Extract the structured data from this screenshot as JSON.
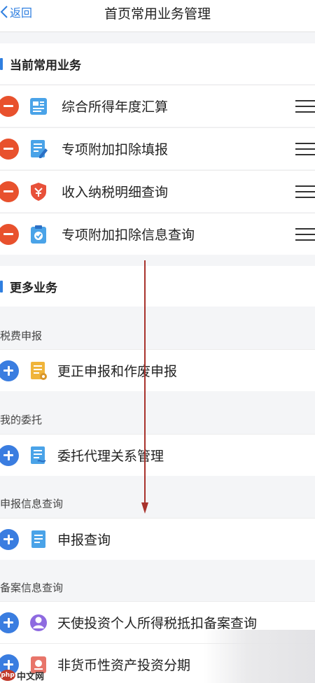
{
  "nav": {
    "back_label": "返回",
    "title": "首页常用业务管理"
  },
  "current": {
    "title": "当前常用业务",
    "items": [
      {
        "label": "综合所得年度汇算",
        "icon": "annual-settlement-icon"
      },
      {
        "label": "专项附加扣除填报",
        "icon": "form-edit-icon"
      },
      {
        "label": "收入纳税明细查询",
        "icon": "tax-shield-icon"
      },
      {
        "label": "专项附加扣除信息查询",
        "icon": "clipboard-check-icon"
      }
    ]
  },
  "more": {
    "title": "更多业务",
    "groups": [
      {
        "label": "税费申报",
        "items": [
          {
            "label": "更正申报和作废申报",
            "icon": "correction-doc-icon"
          }
        ]
      },
      {
        "label": "我的委托",
        "items": [
          {
            "label": "委托代理关系管理",
            "icon": "agency-doc-icon"
          }
        ]
      },
      {
        "label": "申报信息查询",
        "items": [
          {
            "label": "申报查询",
            "icon": "report-doc-icon"
          }
        ]
      },
      {
        "label": "备案信息查询",
        "items": [
          {
            "label": "天使投资个人所得税抵扣备案查询",
            "icon": "person-icon"
          },
          {
            "label": "非货币性资产投资分期",
            "icon": "asset-icon"
          }
        ]
      }
    ]
  },
  "watermark": {
    "logo_text": "中文网",
    "logo_badge": "php"
  },
  "colors": {
    "accent": "#2f7fe0",
    "remove": "#e8512d",
    "add": "#3a7de0",
    "annotation_arrow": "#a8322c"
  }
}
